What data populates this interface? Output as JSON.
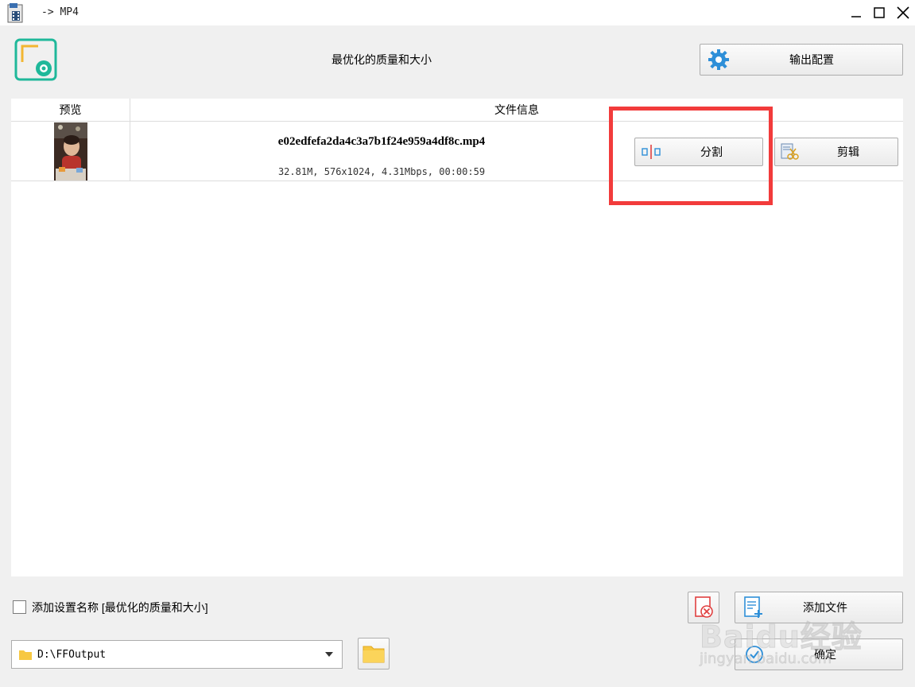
{
  "window": {
    "title": "-> MP4"
  },
  "header": {
    "profile_name": "最优化的质量和大小",
    "output_config_label": "输出配置"
  },
  "table": {
    "columns": [
      "预览",
      "文件信息"
    ],
    "rows": [
      {
        "filename": "e02edfefa2da4c3a7b1f24e959a4df8c.mp4",
        "info": "32.81M, 576x1024, 4.31Mbps, 00:00:59",
        "split_label": "分割",
        "edit_label": "剪辑"
      }
    ]
  },
  "footer": {
    "checkbox_label": "添加设置名称 [最优化的质量和大小]",
    "checkbox_checked": false,
    "add_file_label": "添加文件",
    "ok_label": "确定",
    "output_path": "D:\\FFOutput"
  },
  "watermark": {
    "brand": "Baidu经验",
    "url": "jingyan.baidu.com"
  },
  "colors": {
    "accent_teal": "#1fb89a",
    "highlight_red": "#f23b3b",
    "gear_blue": "#2e8fd8",
    "folder_yellow": "#f7c842"
  }
}
